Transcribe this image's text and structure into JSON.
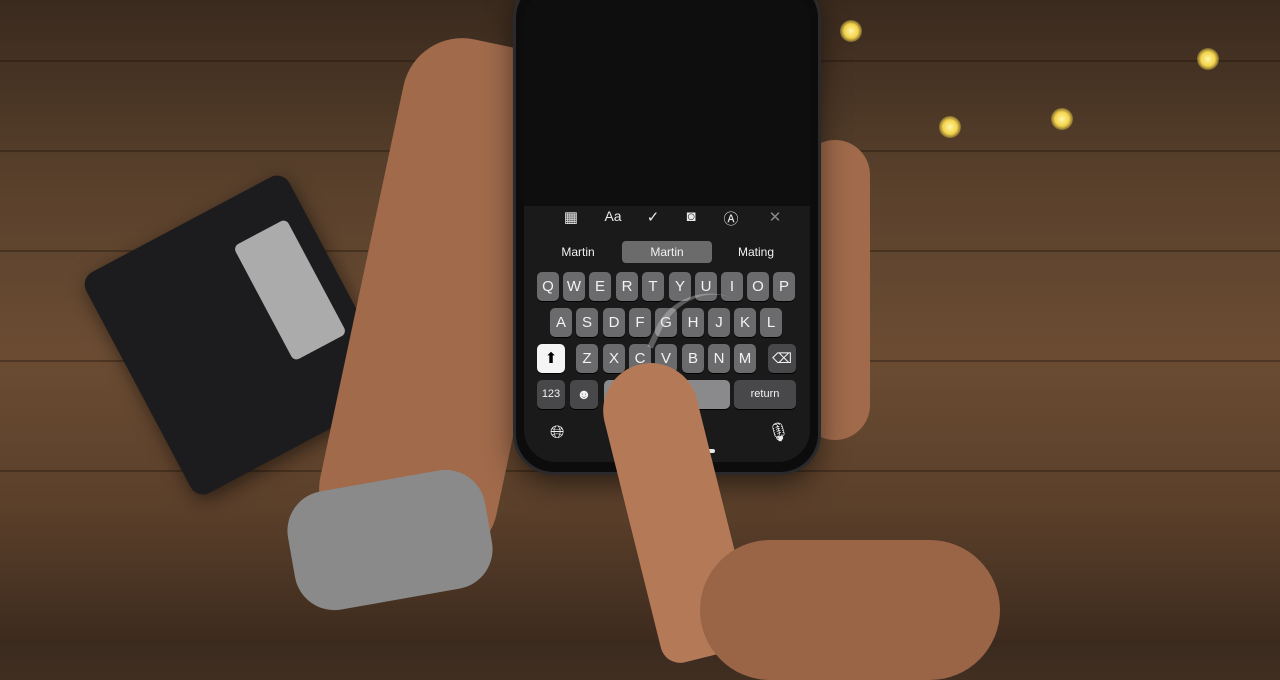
{
  "scene": {
    "description": "Hand holding an iPhone with dark-mode keyboard performing QuickPath swipe typing, on a wooden table with string lights and a wallet",
    "colors": {
      "table": "#5a412c",
      "keyboard_bg": "#1a1a1b",
      "key": "#6b6b6d",
      "key_dark": "#48484a",
      "shift_active": "#f5f5f5",
      "lights": "#f3d34a"
    }
  },
  "toolbar": {
    "icons": [
      "table-icon",
      "format-text-icon",
      "checklist-icon",
      "camera-icon",
      "markup-icon",
      "close-icon"
    ],
    "format_label": "Aa"
  },
  "suggestions": [
    "Martin",
    "Martin",
    "Mating"
  ],
  "keyboard": {
    "row1": [
      "Q",
      "W",
      "E",
      "R",
      "T",
      "Y",
      "U",
      "I",
      "O",
      "P"
    ],
    "row2": [
      "A",
      "S",
      "D",
      "F",
      "G",
      "H",
      "J",
      "K",
      "L"
    ],
    "row3": [
      "Z",
      "X",
      "C",
      "V",
      "B",
      "N",
      "M"
    ],
    "numbers_label": "123",
    "return_label": "return",
    "space_label": "",
    "shift_state": "active"
  }
}
